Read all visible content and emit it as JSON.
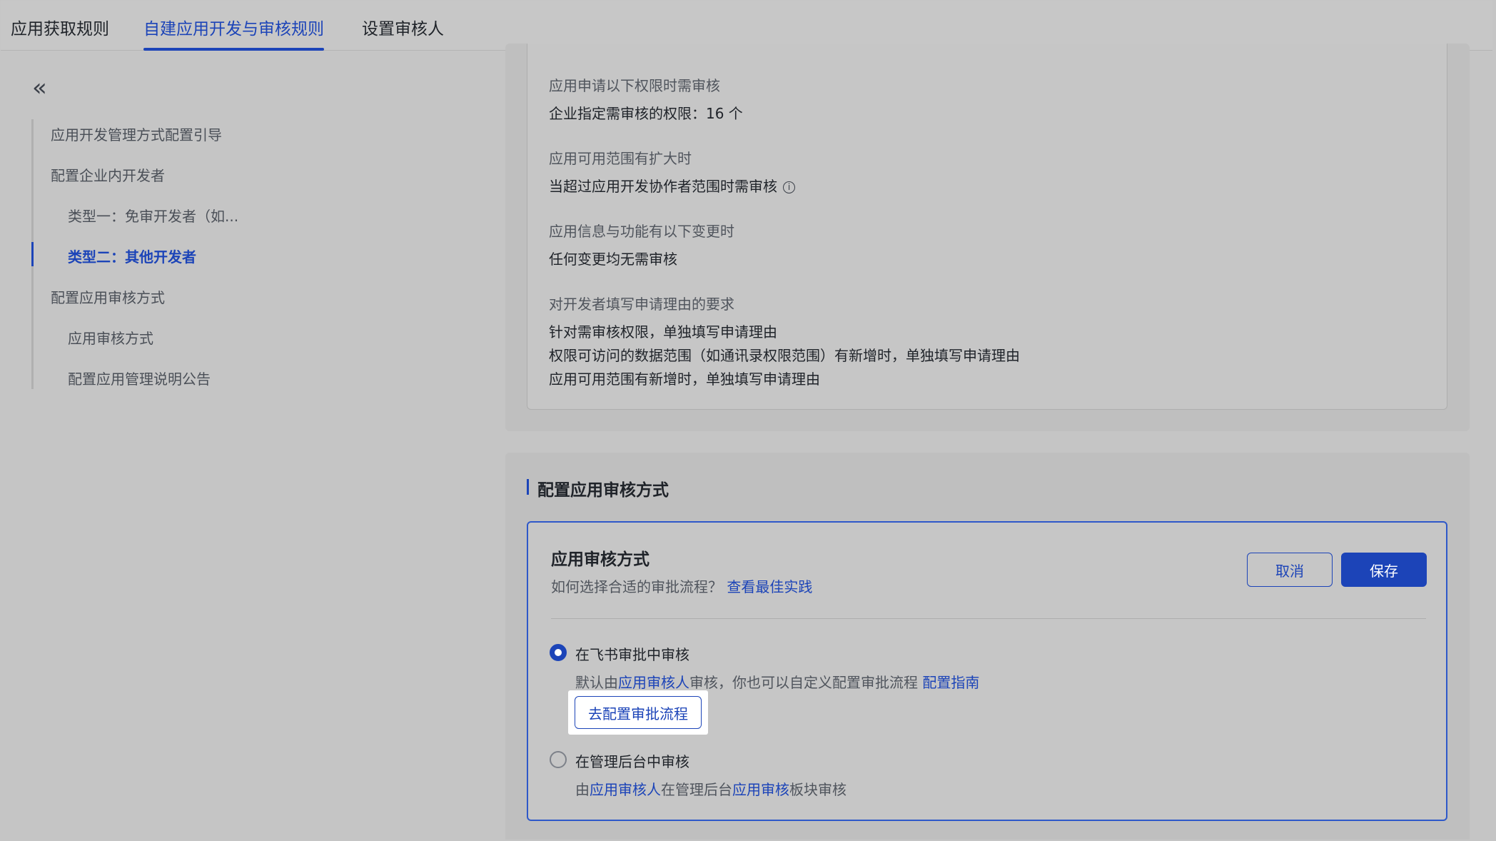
{
  "tabs": [
    {
      "label": "应用获取规则"
    },
    {
      "label": "自建应用开发与审核规则"
    },
    {
      "label": "设置审核人"
    }
  ],
  "sidebar": {
    "collapse_icon": "«",
    "items": [
      {
        "label": "应用开发管理方式配置引导"
      },
      {
        "label": "配置企业内开发者"
      },
      {
        "label": "类型一：免审开发者（如..."
      },
      {
        "label": "类型二：其他开发者"
      },
      {
        "label": "配置应用审核方式"
      },
      {
        "label": "应用审核方式"
      },
      {
        "label": "配置应用管理说明公告"
      }
    ]
  },
  "rules": {
    "perm_label": "应用申请以下权限时需审核",
    "perm_value": "企业指定需审核的权限：16 个",
    "scope_label": "应用可用范围有扩大时",
    "scope_value": "当超过应用开发协作者范围时需审核",
    "info_icon": "i",
    "change_label": "应用信息与功能有以下变更时",
    "change_value": "任何变更均无需审核",
    "reason_label": "对开发者填写申请理由的要求",
    "reason_1": "针对需审核权限，单独填写申请理由",
    "reason_2": "权限可访问的数据范围（如通讯录权限范围）有新增时，单独填写申请理由",
    "reason_3": "应用可用范围有新增时，单独填写申请理由"
  },
  "review": {
    "section_title": "配置应用审核方式",
    "panel_title": "应用审核方式",
    "sub_text": "如何选择合适的审批流程？",
    "sub_link": "查看最佳实践",
    "cancel_label": "取消",
    "save_label": "保存",
    "option1": {
      "label": "在飞书审批中审核",
      "desc_prefix": "默认由",
      "desc_link1": "应用审核人",
      "desc_mid": "审核，你也可以自定义配置审批流程",
      "desc_link2": "配置指南",
      "button": "去配置审批流程",
      "selected": true
    },
    "option2": {
      "label": "在管理后台中审核",
      "desc_prefix": "由",
      "desc_link1": "应用审核人",
      "desc_mid": "在管理后台",
      "desc_link2": "应用审核",
      "desc_suffix": "板块审核",
      "selected": false
    }
  },
  "colors": {
    "accent": "#1c44b8",
    "background": "#c5c5c5"
  }
}
